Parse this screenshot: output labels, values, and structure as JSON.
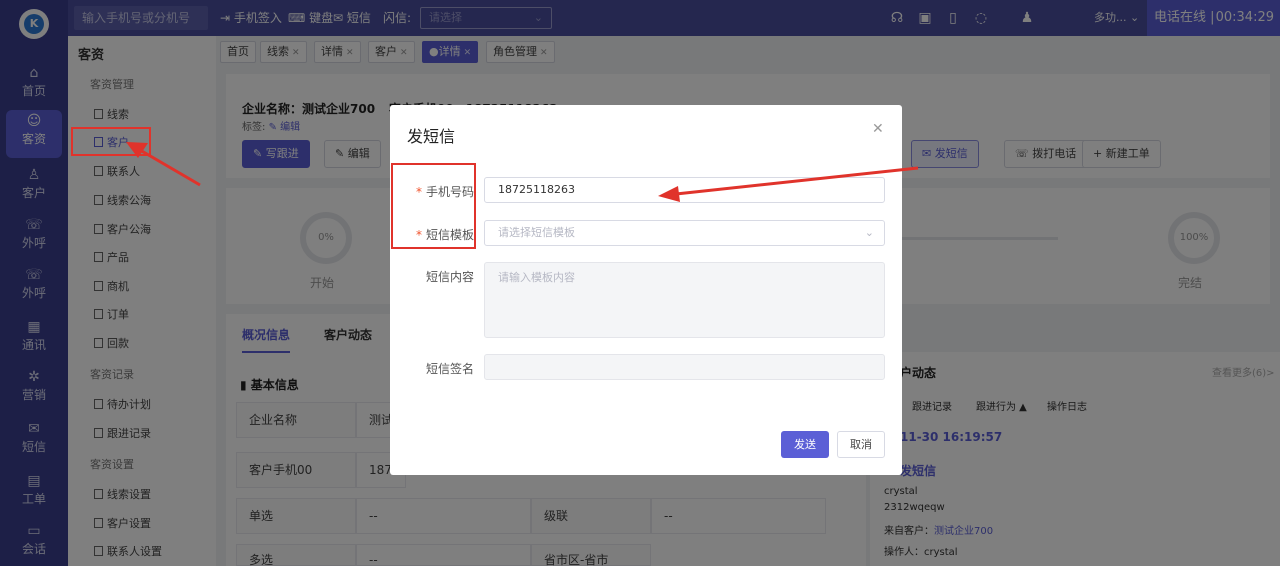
{
  "nav": {
    "logo": "K",
    "items": [
      {
        "label": "首页",
        "icon": "home-icon",
        "glyph": "⌂"
      },
      {
        "label": "客资",
        "icon": "users-icon",
        "glyph": "☺"
      },
      {
        "label": "客户",
        "icon": "person-icon",
        "glyph": "♙"
      },
      {
        "label": "外呼",
        "icon": "phone-out-icon",
        "glyph": "☏"
      },
      {
        "label": "外呼",
        "icon": "phone-call-icon",
        "glyph": "☏"
      },
      {
        "label": "通讯",
        "icon": "grid-icon",
        "glyph": "▦"
      },
      {
        "label": "营销",
        "icon": "gear-icon",
        "glyph": "✲"
      },
      {
        "label": "短信",
        "icon": "mail-icon",
        "glyph": "✉"
      },
      {
        "label": "工单",
        "icon": "clipboard-icon",
        "glyph": "▤"
      },
      {
        "label": "会话",
        "icon": "chat-icon",
        "glyph": "▭"
      }
    ]
  },
  "topbar": {
    "search_placeholder": "输入手机号或分机号",
    "checkin": "手机签入",
    "keyboard": "键盘",
    "sms": "短信",
    "flash_label": "闪信:",
    "flash_placeholder": "请选择",
    "user": "多功...",
    "status": "电话在线 |",
    "time": "00:34:29"
  },
  "subnav": {
    "title": "客资",
    "groups": [
      "客资管理",
      "客资记录",
      "客资设置"
    ],
    "items_mgmt": [
      "线索",
      "客户",
      "联系人",
      "线索公海",
      "客户公海",
      "产品",
      "商机",
      "订单",
      "回款"
    ],
    "items_records": [
      "待办计划",
      "跟进记录"
    ],
    "items_settings": [
      "线索设置",
      "客户设置",
      "联系人设置"
    ]
  },
  "tabs": [
    {
      "label": "首页",
      "close": false,
      "active": false
    },
    {
      "label": "线索",
      "close": true,
      "active": false
    },
    {
      "label": "详情",
      "close": true,
      "active": false
    },
    {
      "label": "客户",
      "close": true,
      "active": false
    },
    {
      "label": "详情",
      "close": true,
      "active": true
    },
    {
      "label": "角色管理",
      "close": true,
      "active": false
    }
  ],
  "detail": {
    "company": "企业名称：测试企业700",
    "phone": "客户手机00：18725118263",
    "tag_label": "标签:",
    "tag_edit": "编辑",
    "btn_follow": "写跟进",
    "btn_edit": "编辑",
    "btn_sms": "发短信",
    "btn_call": "拨打电话",
    "btn_ticket": "新建工单",
    "start_pct": "0%",
    "start_label": "开始",
    "end_pct": "100%",
    "end_label": "完结",
    "tab_overview": "概况信息",
    "tab_dynamics": "客户动态",
    "basic_info": "基本信息",
    "rows": [
      {
        "k": "企业名称",
        "v": "测试"
      },
      {
        "k": "客户手机00",
        "v": "187"
      },
      {
        "k": "单选",
        "v": "--",
        "k2": "级联",
        "v2": "--"
      },
      {
        "k": "多选",
        "v": "--",
        "k2": "省市区-省市",
        "v2": ""
      }
    ],
    "side_title": "户动态",
    "side_more": "查看更多(6)>",
    "side_tabs": [
      "跟进记录",
      "跟进行为 ▲",
      "操作日志"
    ],
    "side_time": "11-30 16:19:57",
    "side_event": "发短信",
    "side_user": "crystal",
    "side_content": "2312wqeqw",
    "side_from_label": "来自客户：",
    "side_from_value": "测试企业700",
    "side_operator": "操作人：crystal"
  },
  "modal": {
    "title": "发短信",
    "phone_label": "手机号码",
    "phone_value": "18725118263",
    "template_label": "短信模板",
    "template_placeholder": "请选择短信模板",
    "content_label": "短信内容",
    "content_placeholder": "请输入模板内容",
    "sign_label": "短信签名",
    "sign_value": "",
    "send": "发送",
    "cancel": "取消"
  },
  "colors": {
    "brand": "#5b5fd6",
    "nav_bg": "#3b3f8f",
    "annotation": "#e0332b"
  }
}
